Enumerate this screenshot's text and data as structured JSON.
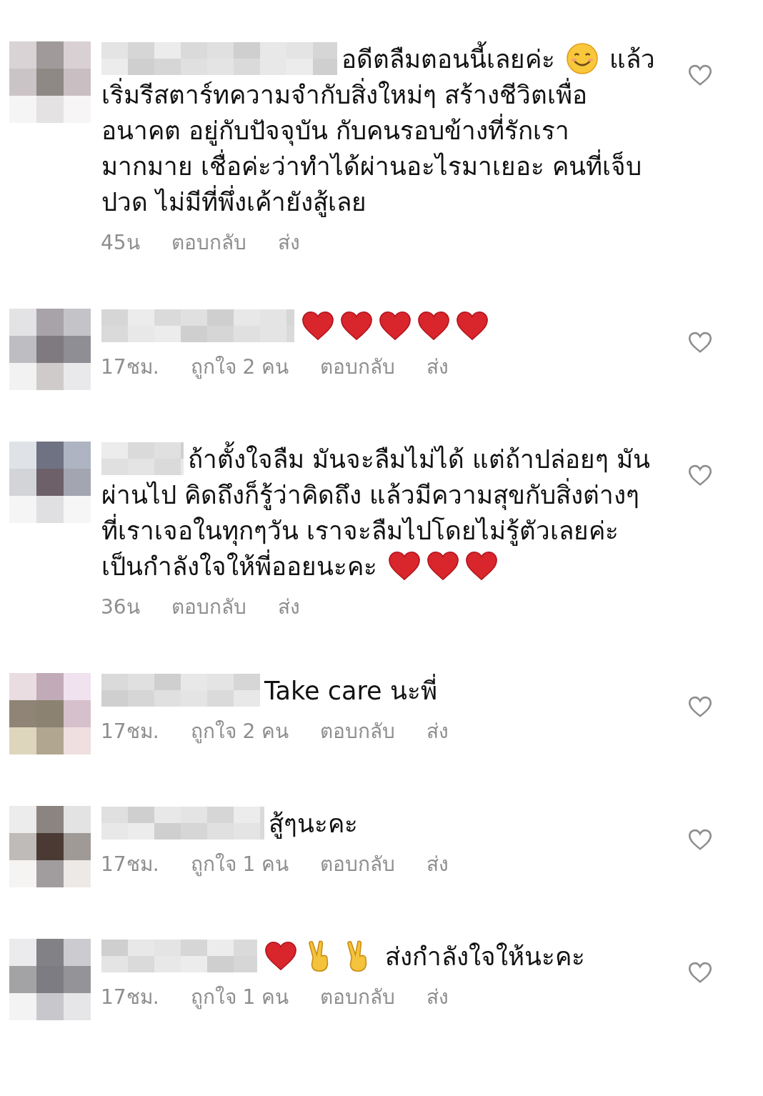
{
  "comments": [
    {
      "segments": [
        {
          "kind": "text",
          "text": "อดีตลืมตอนนี้เลยค่ะ "
        },
        {
          "kind": "smile"
        },
        {
          "kind": "text",
          "text": " แล้วเริ่มรีสตาร์ทความจำกับสิ่งใหม่ๆ  สร้างชีวิตเพื่ออนาคต อยู่กับปัจจุบัน กับคนรอบข้างที่รักเรามากมาย เชื่อค่ะว่าทำได้ผ่านอะไรมาเยอะ คนที่เจ็บปวด ไม่มีที่พึ่งเค้ายังสู้เลย"
        }
      ],
      "meta": {
        "time": "45น",
        "reply": "ตอบกลับ",
        "send": "ส่ง"
      },
      "liked": false
    },
    {
      "segments": [
        {
          "kind": "heart"
        },
        {
          "kind": "heart"
        },
        {
          "kind": "heart"
        },
        {
          "kind": "heart"
        },
        {
          "kind": "heart"
        }
      ],
      "meta": {
        "time": "17ชม.",
        "likes": "ถูกใจ 2 คน",
        "reply": "ตอบกลับ",
        "send": "ส่ง"
      },
      "liked": false
    },
    {
      "segments": [
        {
          "kind": "text",
          "text": "ถ้าตั้งใจลืม มันจะลืมไม่ได้ แต่ถ้าปล่อยๆ มันผ่านไป คิดถึงก็รู้ว่าคิดถึง แล้วมีความสุขกับสิ่งต่างๆ ที่เราเจอในทุกๆวัน เราจะลืมไปโดยไม่รู้ตัวเลยค่ะ\nเป็นกำลังใจให้พี่ออยนะคะ "
        },
        {
          "kind": "heart"
        },
        {
          "kind": "heart"
        },
        {
          "kind": "heart"
        }
      ],
      "meta": {
        "time": "36น",
        "reply": "ตอบกลับ",
        "send": "ส่ง"
      },
      "liked": false
    },
    {
      "segments": [
        {
          "kind": "text",
          "text": "Take care นะพี่"
        }
      ],
      "meta": {
        "time": "17ชม.",
        "likes": "ถูกใจ 2 คน",
        "reply": "ตอบกลับ",
        "send": "ส่ง"
      },
      "liked": false
    },
    {
      "segments": [
        {
          "kind": "text",
          "text": "สู้ๆนะคะ"
        }
      ],
      "meta": {
        "time": "17ชม.",
        "likes": "ถูกใจ 1 คน",
        "reply": "ตอบกลับ",
        "send": "ส่ง"
      },
      "liked": false
    },
    {
      "segments": [
        {
          "kind": "heart"
        },
        {
          "kind": "peace"
        },
        {
          "kind": "peace"
        },
        {
          "kind": "text",
          "text": " ส่งกำลังใจให้นะคะ"
        }
      ],
      "meta": {
        "time": "17ชม.",
        "likes": "ถูกใจ 1 คน",
        "reply": "ตอบกลับ",
        "send": "ส่ง"
      },
      "liked": false
    }
  ]
}
